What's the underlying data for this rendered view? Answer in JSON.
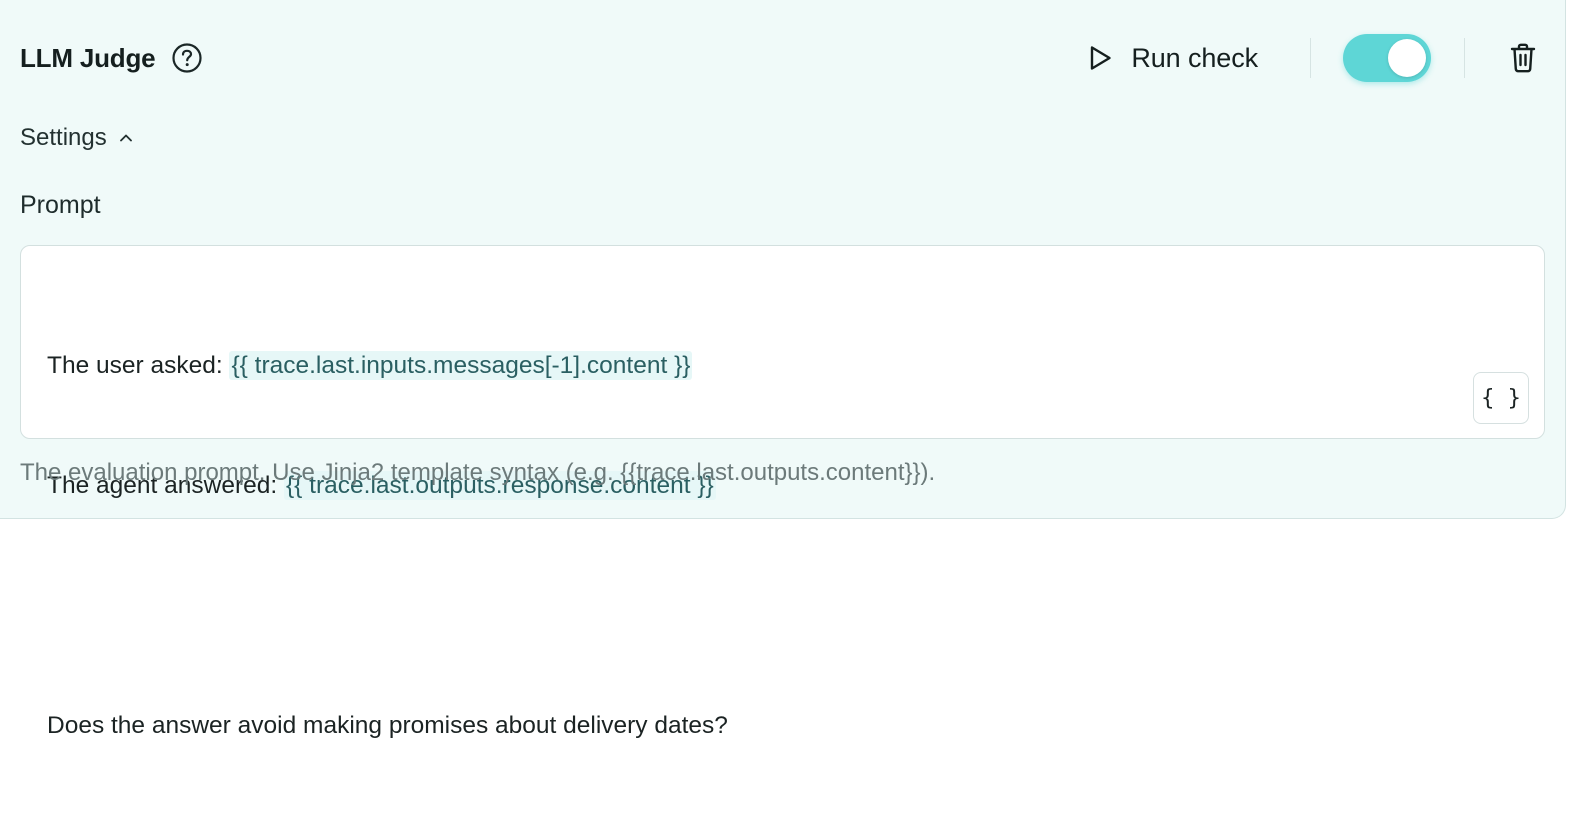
{
  "header": {
    "title": "LLM Judge",
    "run_label": "Run check",
    "toggle_enabled": true
  },
  "settings": {
    "label": "Settings"
  },
  "prompt": {
    "label": "Prompt",
    "line1_prefix": "The user asked: ",
    "line1_var": "{{ trace.last.inputs.messages[-1].content }}",
    "line2_prefix": "The agent answered: ",
    "line2_var": "{{ trace.last.outputs.response.content }}",
    "line3": "",
    "line4": "Does the answer avoid making promises about delivery dates?",
    "brace_button": "{ }",
    "helper": "The evaluation prompt. Use Jinja2 template syntax (e.g. {{trace.last.outputs.content}})."
  },
  "colors": {
    "card_bg": "#f0faf9",
    "accent": "#5ed6d6",
    "variable_bg": "#e6f7f7",
    "helper_text": "#6c7a7a"
  },
  "icons": {
    "help": "question-circle-icon",
    "run": "play-icon",
    "collapse": "chevron-up-icon",
    "delete": "trash-icon"
  }
}
